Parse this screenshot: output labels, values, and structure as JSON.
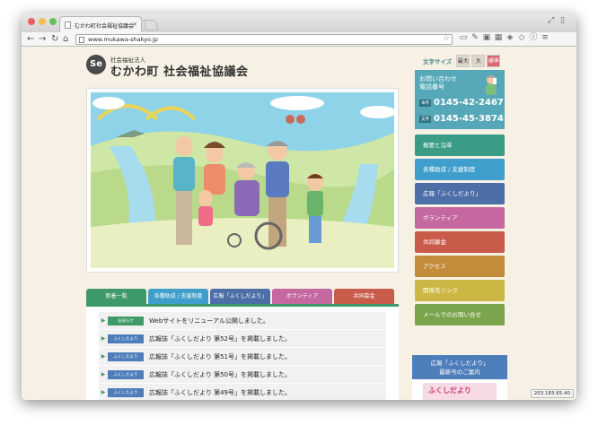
{
  "browser": {
    "tab_title": "むかわ町社会福祉協議会",
    "close_glyph": "×",
    "url": "www.mukawa-shakyo.jp",
    "traffic_colors": [
      "#ee5f57",
      "#f6be4f",
      "#61c454"
    ]
  },
  "header": {
    "logo_glyph": "Se",
    "org_type": "社会福祉法人",
    "org_name": "むかわ町 社会福祉協議会"
  },
  "font_size": {
    "label": "文字サイズ",
    "options": [
      "最大",
      "大",
      "標準"
    ],
    "active": "標準"
  },
  "contact": {
    "title_line1": "お問い合わせ",
    "title_line2": "電話番号",
    "phones": [
      {
        "tag": "本所",
        "number": "0145-42-2467"
      },
      {
        "tag": "支所",
        "number": "0145-45-3874"
      }
    ]
  },
  "sidebar": {
    "items": [
      {
        "label": "概要と沿革",
        "color": "#3a9c86"
      },
      {
        "label": "各種助成 / 支援制度",
        "color": "#3f9ecb"
      },
      {
        "label": "広報「ふくしだより」",
        "color": "#4d6fa8"
      },
      {
        "label": "ボランティア",
        "color": "#c4689f"
      },
      {
        "label": "共同募金",
        "color": "#c95b4a"
      },
      {
        "label": "アクセス",
        "color": "#c38b3a"
      },
      {
        "label": "関係先リンク",
        "color": "#cdb744"
      },
      {
        "label": "メールでのお問い合せ",
        "color": "#7aa54c"
      }
    ]
  },
  "tabs": [
    {
      "label": "新着一覧",
      "color": "#3f9a6a"
    },
    {
      "label": "各種助成 / 支援制度",
      "color": "#3f9ecb"
    },
    {
      "label": "広報「ふくしだより」",
      "color": "#4d6fa8"
    },
    {
      "label": "ボランティア",
      "color": "#c4689f"
    },
    {
      "label": "共同募金",
      "color": "#c95b4a"
    }
  ],
  "news": [
    {
      "badge": "お知らせ",
      "text": "Webサイトをリニューアル公開しました。",
      "badge_style": "g"
    },
    {
      "badge": "ふくしだより",
      "text": "広報誌「ふくしだより 第52号」を掲載しました。",
      "badge_style": "b"
    },
    {
      "badge": "ふくしだより",
      "text": "広報誌「ふくしだより 第51号」を掲載しました。",
      "badge_style": "b"
    },
    {
      "badge": "ふくしだより",
      "text": "広報誌「ふくしだより 第50号」を掲載しました。",
      "badge_style": "b"
    },
    {
      "badge": "ふくしだより",
      "text": "広報誌「ふくしだより 第49号」を掲載しました。",
      "badge_style": "b"
    }
  ],
  "banner": {
    "title_line1": "広報「ふくしだより」",
    "title_line2": "最新号のご案内",
    "cover_text": "ふくしだより"
  },
  "status_text": "203.183.65.40"
}
